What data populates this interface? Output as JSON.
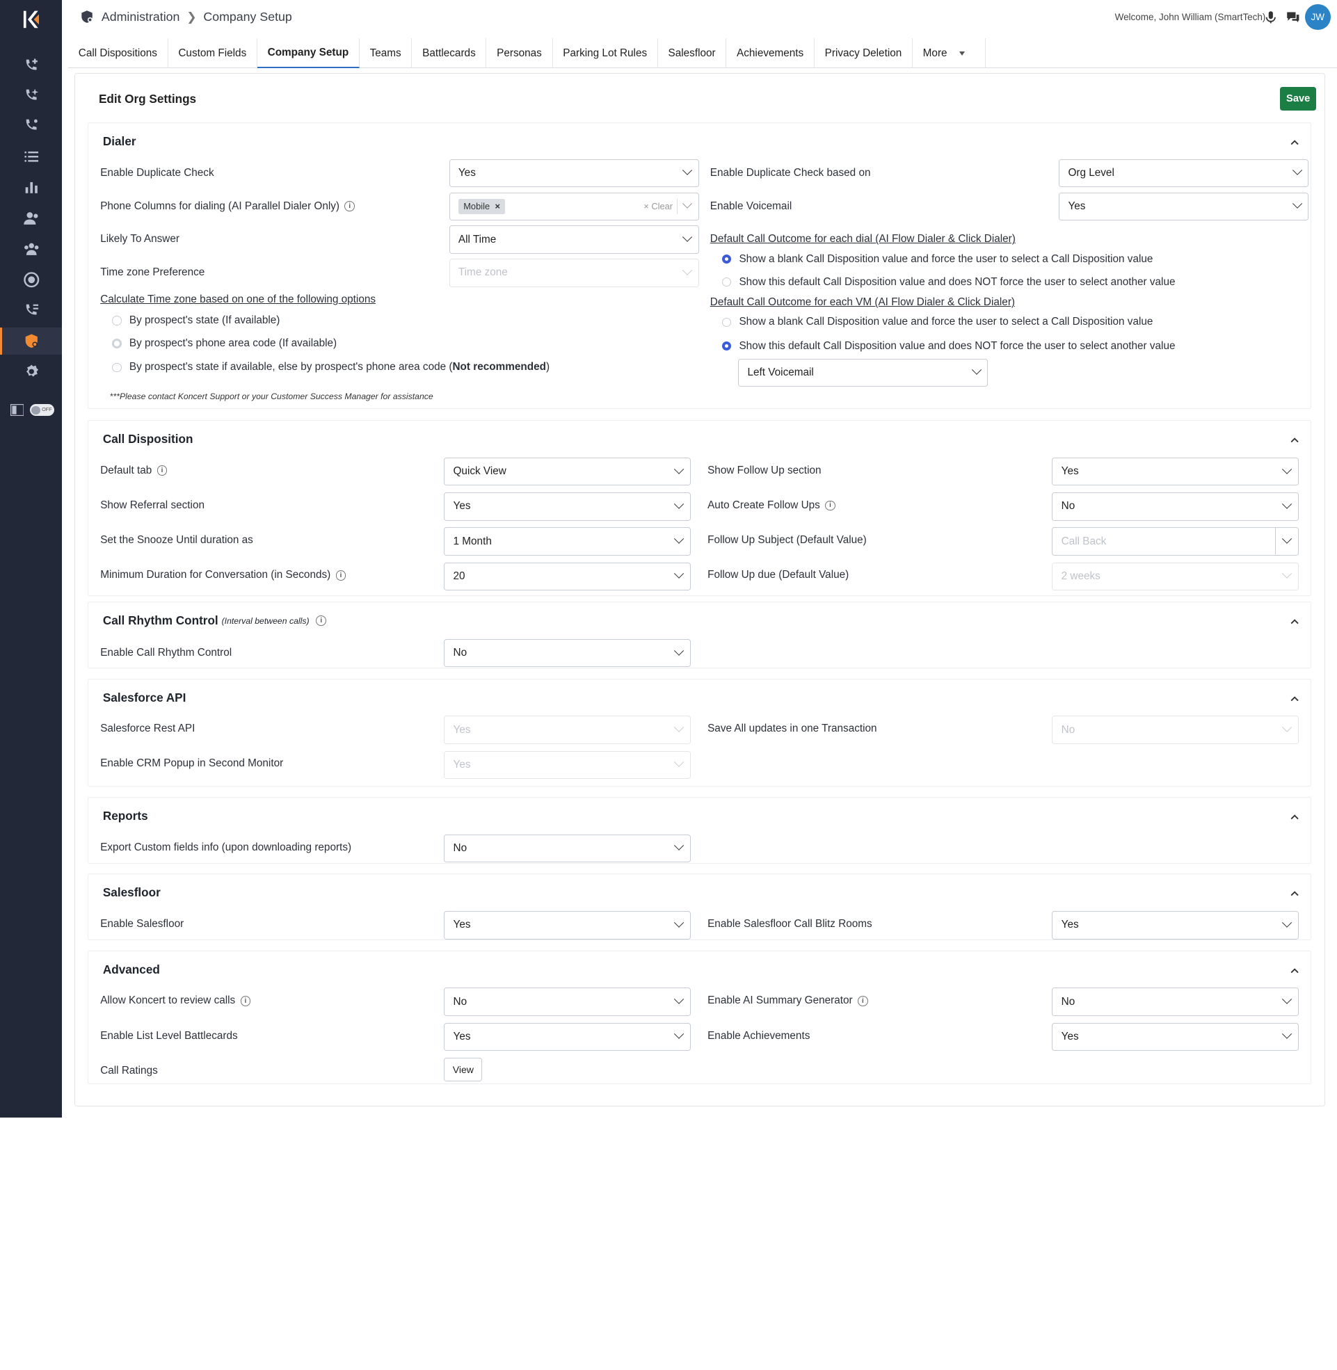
{
  "topbar": {
    "breadcrumb_root": "Administration",
    "breadcrumb_current": "Company Setup",
    "welcome": "Welcome, John William (SmartTech)",
    "avatar": "JW"
  },
  "sidebar": {
    "toggle": "OFF"
  },
  "tabs": [
    "Call Dispositions",
    "Custom Fields",
    "Company Setup",
    "Teams",
    "Battlecards",
    "Personas",
    "Parking Lot Rules",
    "Salesfloor",
    "Achievements",
    "Privacy Deletion",
    "More"
  ],
  "active_tab": "Company Setup",
  "page": {
    "title": "Edit Org Settings",
    "save": "Save"
  },
  "dialer": {
    "title": "Dialer",
    "dup_check": {
      "label": "Enable Duplicate Check",
      "value": "Yes"
    },
    "dup_based": {
      "label": "Enable Duplicate Check based on",
      "value": "Org Level"
    },
    "phone_cols": {
      "label": "Phone Columns for dialing (AI Parallel Dialer Only)",
      "tag": "Mobile",
      "clear": "Clear"
    },
    "voicemail": {
      "label": "Enable Voicemail",
      "value": "Yes"
    },
    "likely": {
      "label": "Likely To Answer",
      "value": "All Time"
    },
    "tz_pref": {
      "label": "Time zone Preference",
      "placeholder": "Time zone"
    },
    "tz_calc": {
      "label": "Calculate Time zone based on one of the following options",
      "opt1": "By prospect's state (If available)",
      "opt2": "By prospect's phone area code (If available)",
      "opt3_a": "By prospect's state if available, else by prospect's phone area code (",
      "opt3_b": "Not recommended",
      "opt3_c": ")"
    },
    "note": "***Please contact Koncert Support or your Customer Success Manager for assistance",
    "dial_outcome": {
      "label": "Default Call Outcome for each dial (AI Flow Dialer & Click Dialer)",
      "opt1": "Show a blank Call Disposition value and force the user to select a Call Disposition value",
      "opt2": "Show this default Call Disposition value and does NOT force the user to select another value"
    },
    "vm_outcome": {
      "label": "Default Call Outcome for each VM (AI Flow Dialer & Click Dialer)",
      "opt1": "Show a blank Call Disposition value and force the user to select a Call Disposition value",
      "opt2": "Show this default Call Disposition value and does NOT force the user to select another value",
      "value": "Left Voicemail"
    }
  },
  "call_disposition": {
    "title": "Call Disposition",
    "default_tab": {
      "label": "Default tab",
      "value": "Quick View"
    },
    "follow_up": {
      "label": "Show Follow Up section",
      "value": "Yes"
    },
    "referral": {
      "label": "Show Referral section",
      "value": "Yes"
    },
    "auto_follow": {
      "label": "Auto Create Follow Ups",
      "value": "No"
    },
    "snooze": {
      "label": "Set the Snooze Until duration as",
      "value": "1 Month"
    },
    "fu_subject": {
      "label": "Follow Up Subject (Default Value)",
      "placeholder": "Call Back"
    },
    "min_dur": {
      "label": "Minimum Duration for Conversation (in Seconds)",
      "value": "20"
    },
    "fu_due": {
      "label": "Follow Up due (Default Value)",
      "value": "2 weeks"
    }
  },
  "rhythm": {
    "title": "Call Rhythm Control",
    "subtitle": "(Interval between calls)",
    "enable": {
      "label": "Enable Call Rhythm Control",
      "value": "No"
    }
  },
  "salesforce": {
    "title": "Salesforce API",
    "rest": {
      "label": "Salesforce Rest API",
      "value": "Yes"
    },
    "save_all": {
      "label": "Save All updates in one Transaction",
      "value": "No"
    },
    "popup": {
      "label": "Enable CRM Popup in Second Monitor",
      "value": "Yes"
    }
  },
  "reports": {
    "title": "Reports",
    "export": {
      "label": "Export Custom fields info (upon downloading reports)",
      "value": "No"
    }
  },
  "salesfloor": {
    "title": "Salesfloor",
    "enable": {
      "label": "Enable Salesfloor",
      "value": "Yes"
    },
    "blitz": {
      "label": "Enable Salesfloor Call Blitz Rooms",
      "value": "Yes"
    }
  },
  "advanced": {
    "title": "Advanced",
    "review": {
      "label": "Allow Koncert to review calls",
      "value": "No"
    },
    "ai_summary": {
      "label": "Enable AI Summary Generator",
      "value": "No"
    },
    "battlecards": {
      "label": "Enable List Level Battlecards",
      "value": "Yes"
    },
    "achievements": {
      "label": "Enable Achievements",
      "value": "Yes"
    },
    "ratings": {
      "label": "Call Ratings",
      "button": "View"
    }
  },
  "colors": {
    "sidebar": "#232838",
    "accent": "#f28a32",
    "save": "#1b7f45",
    "radio": "#3b5bdb",
    "avatar": "#2c84c6"
  }
}
